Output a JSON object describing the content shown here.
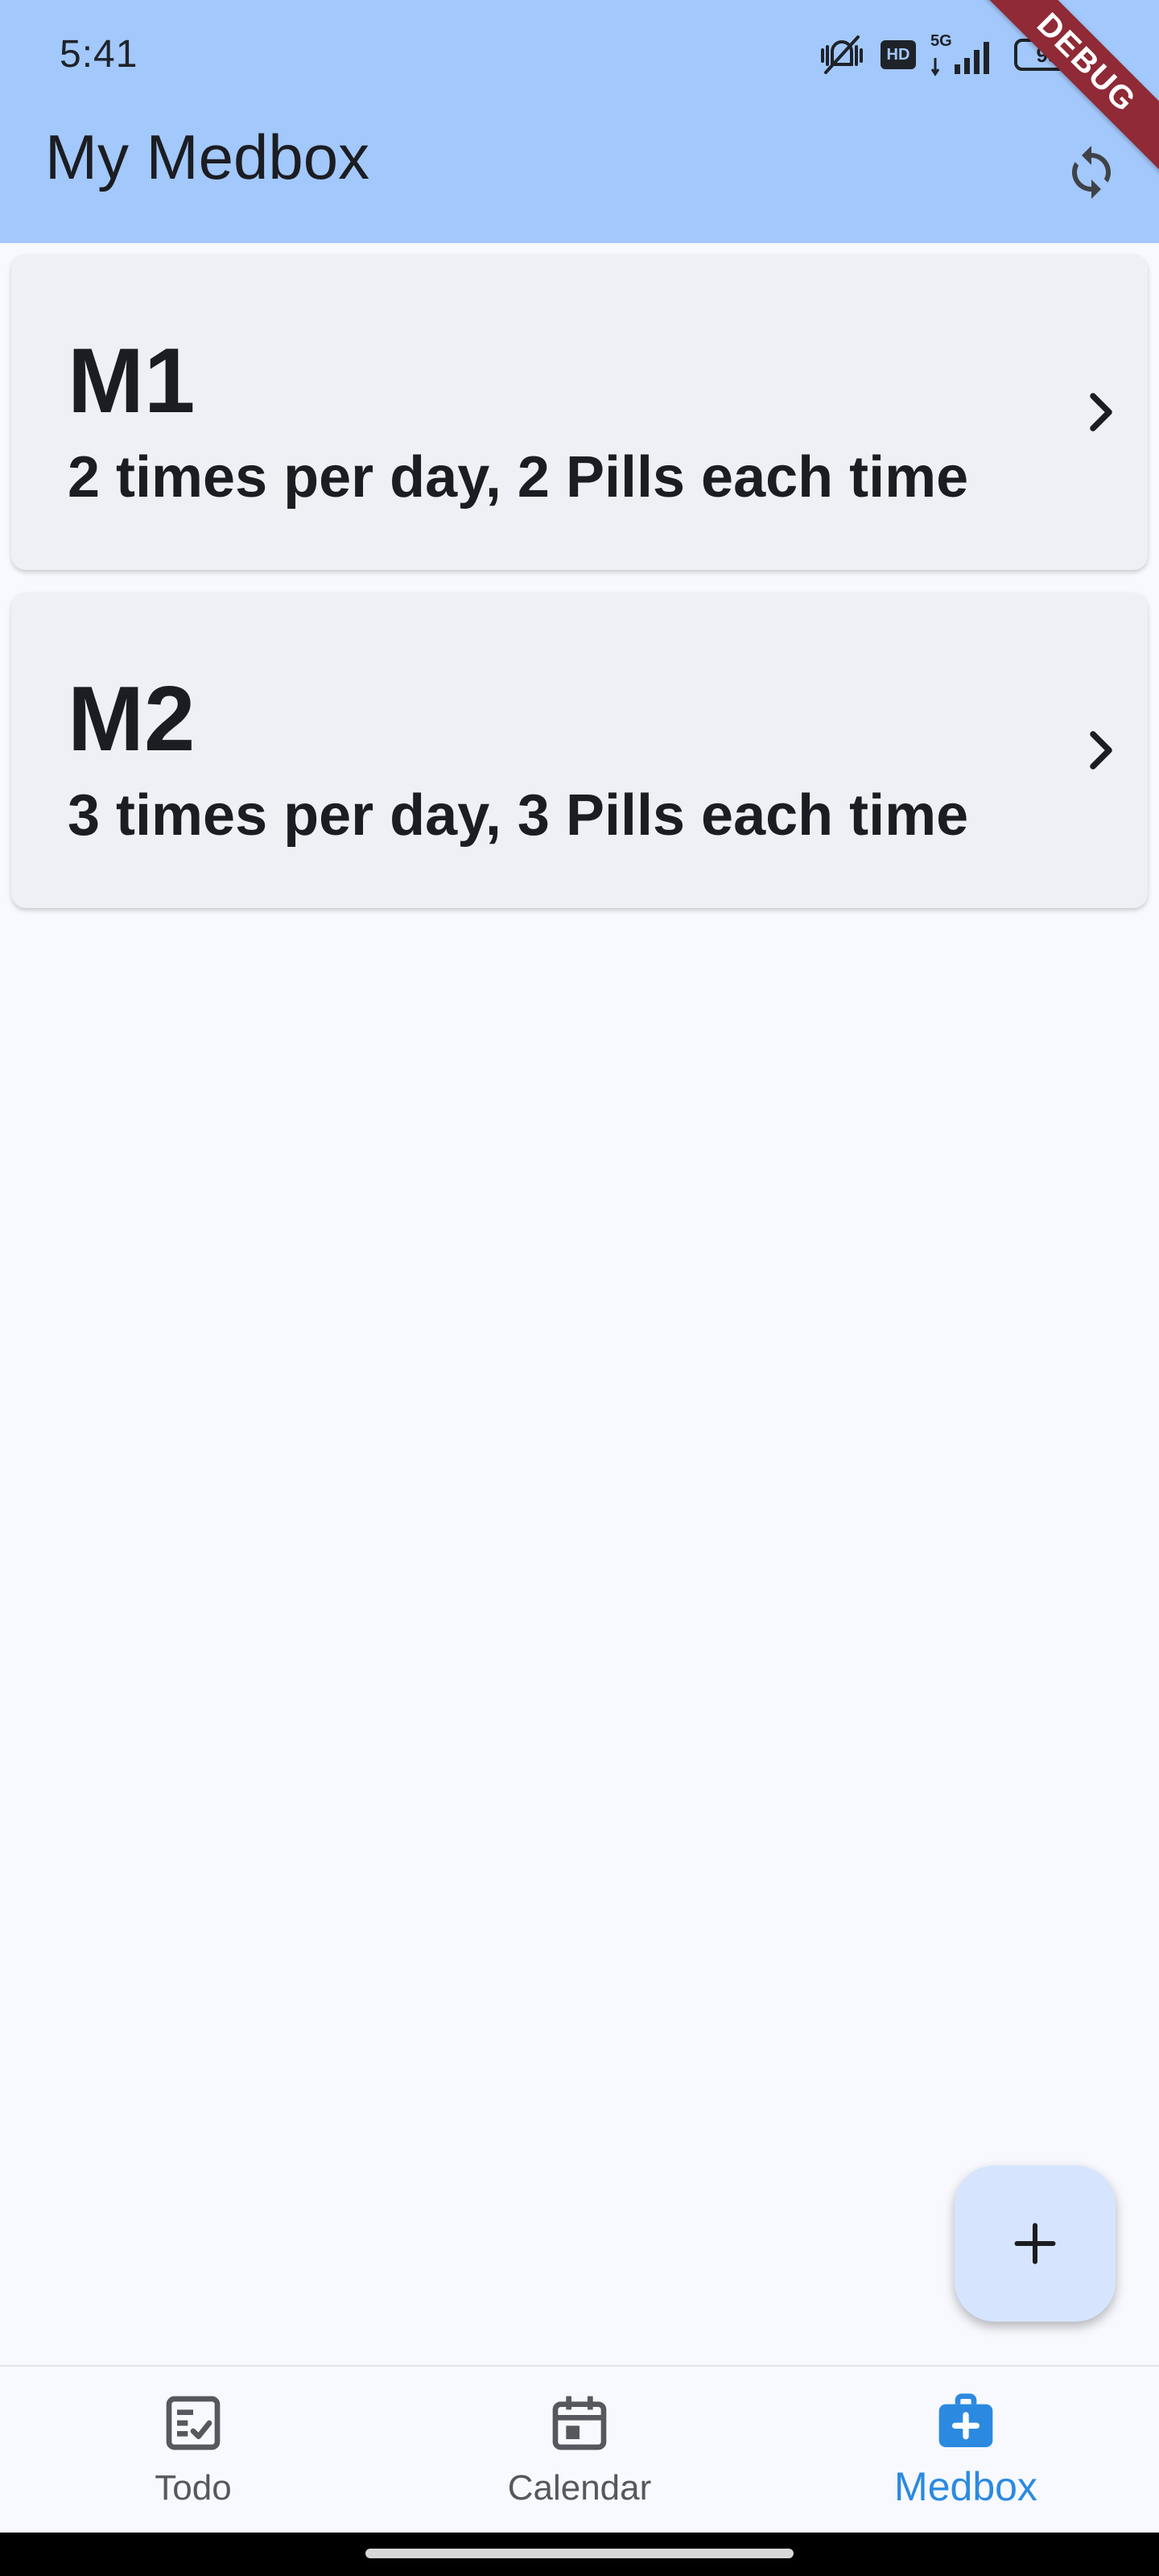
{
  "status_bar": {
    "time": "5:41",
    "network": "5G",
    "hd": "HD",
    "battery": "93"
  },
  "app_bar": {
    "title": "My Medbox",
    "sync_icon": "sync-icon",
    "debug_banner": "DEBUG"
  },
  "medicines": [
    {
      "name": "M1",
      "schedule": "2 times per day, 2 Pills each time"
    },
    {
      "name": "M2",
      "schedule": "3 times per day, 3 Pills each time"
    }
  ],
  "fab": {
    "icon": "plus-icon"
  },
  "bottom_nav": {
    "items": [
      {
        "label": "Todo",
        "icon": "todo-list-icon",
        "active": false
      },
      {
        "label": "Calendar",
        "icon": "calendar-icon",
        "active": false
      },
      {
        "label": "Medbox",
        "icon": "medical-bag-icon",
        "active": true
      }
    ]
  },
  "colors": {
    "app_bar": "#a3c8fb",
    "background": "#f7f9fe",
    "card": "#eff0f6",
    "fab": "#d6e5fd",
    "active_nav": "#2b8ae0",
    "debug_ribbon": "#8f2a36"
  }
}
